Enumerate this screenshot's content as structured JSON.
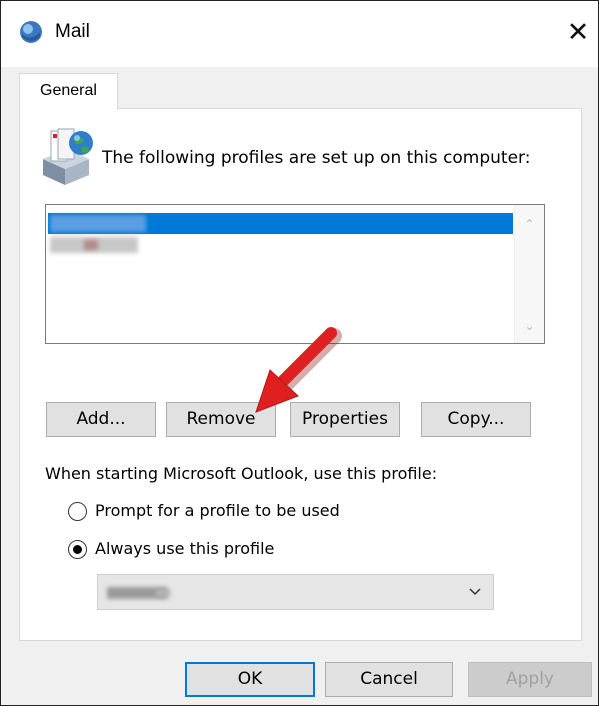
{
  "window": {
    "title": "Mail",
    "close_glyph": "✕",
    "icon": "mail-app-icon"
  },
  "tabs": [
    {
      "label": "General",
      "selected": true
    }
  ],
  "profiles": {
    "heading": "The following profiles are set up on this computer:",
    "icon": "profiles-icon",
    "list_items": [
      {
        "label": "",
        "selected": true,
        "obscured": true
      },
      {
        "label": "",
        "selected": false,
        "obscured": true
      }
    ]
  },
  "buttons": {
    "add": "Add...",
    "remove": "Remove",
    "properties": "Properties",
    "copy": "Copy..."
  },
  "startup": {
    "label": "When starting Microsoft Outlook, use this profile:",
    "options": [
      {
        "label": "Prompt for a profile to be used",
        "checked": false
      },
      {
        "label": "Always use this profile",
        "checked": true
      }
    ],
    "profile_select": {
      "value": "",
      "obscured": true,
      "enabled": false
    }
  },
  "footer": {
    "ok": "OK",
    "cancel": "Cancel",
    "apply": "Apply",
    "apply_enabled": false
  },
  "annotation": {
    "type": "red-arrow",
    "points_to": "remove-button",
    "color": "#e02020"
  },
  "colors": {
    "selection": "#0078d7",
    "button_face": "#e1e1e1",
    "default_button_border": "#0078d7"
  }
}
